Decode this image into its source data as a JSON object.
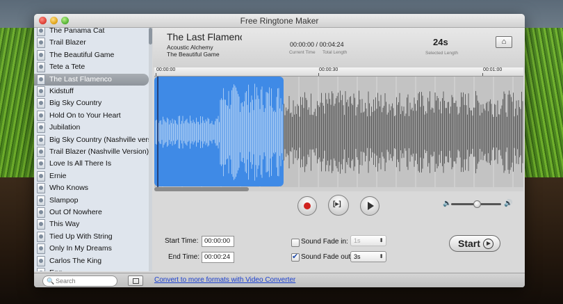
{
  "window": {
    "title": "Free Ringtone Maker"
  },
  "sidebar": {
    "songs": [
      "The Panama Cat",
      "Trail Blazer",
      "The Beautiful Game",
      "Tete a Tete",
      "The Last Flamenco",
      "Kidstuff",
      "Big Sky Country",
      "Hold On to Your Heart",
      "Jubilation",
      "Big Sky Country (Nashville vers",
      "Trail Blazer (Nashville Version)",
      "Love Is All There Is",
      "Ernie",
      "Who Knows",
      "Slampop",
      "Out Of Nowhere",
      "This Way",
      "Tied Up With String",
      "Only In My Dreams",
      "Carlos The King",
      "Egg"
    ],
    "selected_index": 4
  },
  "header": {
    "title": "The Last Flamenco",
    "artist": "Acoustic Alchemy",
    "album": "The Beautiful Game",
    "time": "00:00:00 / 00:04:24",
    "current_label": "Current Time",
    "total_label": "Total Length",
    "selected_length": "24s",
    "selected_label": "Selected Length",
    "home_icon": "home-icon"
  },
  "ruler": {
    "ticks": [
      "00:00:00",
      "00:00:30",
      "00:01:00"
    ]
  },
  "waveform": {
    "selection_start_seconds": 0,
    "selection_end_seconds": 24,
    "colors": {
      "selected": "#3f8ae6",
      "wave_selected": "#a7caf3",
      "wave": "#5e5e5e",
      "background": "#c3c3c3"
    }
  },
  "controls": {
    "record_icon": "record-icon",
    "play_selection_icon": "play-selection-icon",
    "play_icon": "play-icon",
    "volume_level": 0.5
  },
  "form": {
    "start_time_label": "Start Time:",
    "start_time": "00:00:00",
    "end_time_label": "End Time:",
    "end_time": "00:00:24",
    "fade_in_label": "Sound Fade in:",
    "fade_in_checked": false,
    "fade_in_value": "1s",
    "fade_out_label": "Sound Fade out:",
    "fade_out_checked": true,
    "fade_out_value": "3s",
    "start_button": "Start"
  },
  "bottombar": {
    "search_placeholder": "Search",
    "convert_link": "Convert to more formats with Video Converter"
  }
}
